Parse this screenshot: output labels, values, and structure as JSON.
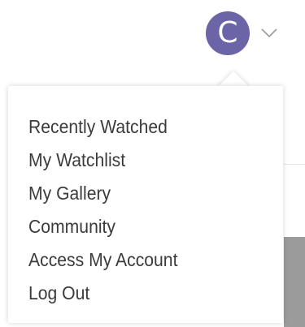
{
  "header": {
    "avatar_initial": "C",
    "avatar_color": "#6b64a7",
    "chevron_icon": "chevron-down-icon"
  },
  "menu": {
    "items": [
      {
        "label": "Recently Watched"
      },
      {
        "label": "My Watchlist"
      },
      {
        "label": "My Gallery"
      },
      {
        "label": "Community"
      },
      {
        "label": "Access My Account"
      },
      {
        "label": "Log Out"
      }
    ]
  }
}
